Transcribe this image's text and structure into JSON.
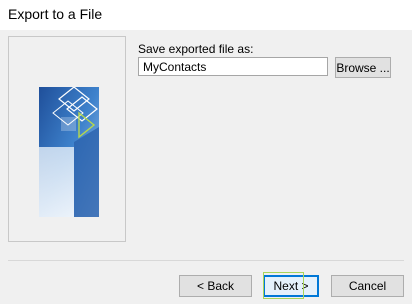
{
  "window": {
    "title": "Export to a File"
  },
  "form": {
    "save_label": "Save exported file as:",
    "file_value": "MyContacts"
  },
  "buttons": {
    "browse_label": "Browse ...",
    "back_label": "< Back",
    "next_label": "Next >",
    "cancel_label": "Cancel"
  },
  "colors": {
    "accent": "#0078d7",
    "focus_highlight": "#a8d45a",
    "art_blue": "#2f6db5"
  },
  "icons": {
    "side_art": "outlook-wizard-graphic"
  }
}
